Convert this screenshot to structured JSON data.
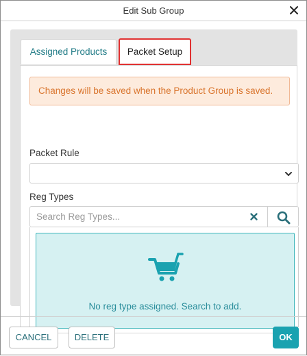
{
  "dialog": {
    "title": "Edit Sub Group",
    "close_icon": "close-icon"
  },
  "tabs": [
    {
      "label": "Assigned Products",
      "selected": false
    },
    {
      "label": "Packet Setup",
      "selected": true
    }
  ],
  "alert": {
    "text": "Changes will be saved when the Product Group is saved."
  },
  "packet_rule": {
    "label": "Packet Rule",
    "value": "",
    "icon": "chevron-down-icon"
  },
  "reg_types": {
    "label": "Reg Types",
    "search_value": "",
    "search_placeholder": "Search Reg Types...",
    "clear_icon": "clear-x-icon",
    "search_icon": "search-icon",
    "empty_icon": "shopping-cart-icon",
    "empty_text": "No reg type assigned. Search to add."
  },
  "footer": {
    "cancel_label": "CANCEL",
    "delete_label": "DELETE",
    "ok_label": "OK"
  },
  "colors": {
    "accent": "#1aa2b0",
    "alert_text": "#d9742c",
    "alert_bg": "#fdebdd",
    "empty_bg": "#d6f1f2",
    "highlight_border": "#e03131"
  }
}
